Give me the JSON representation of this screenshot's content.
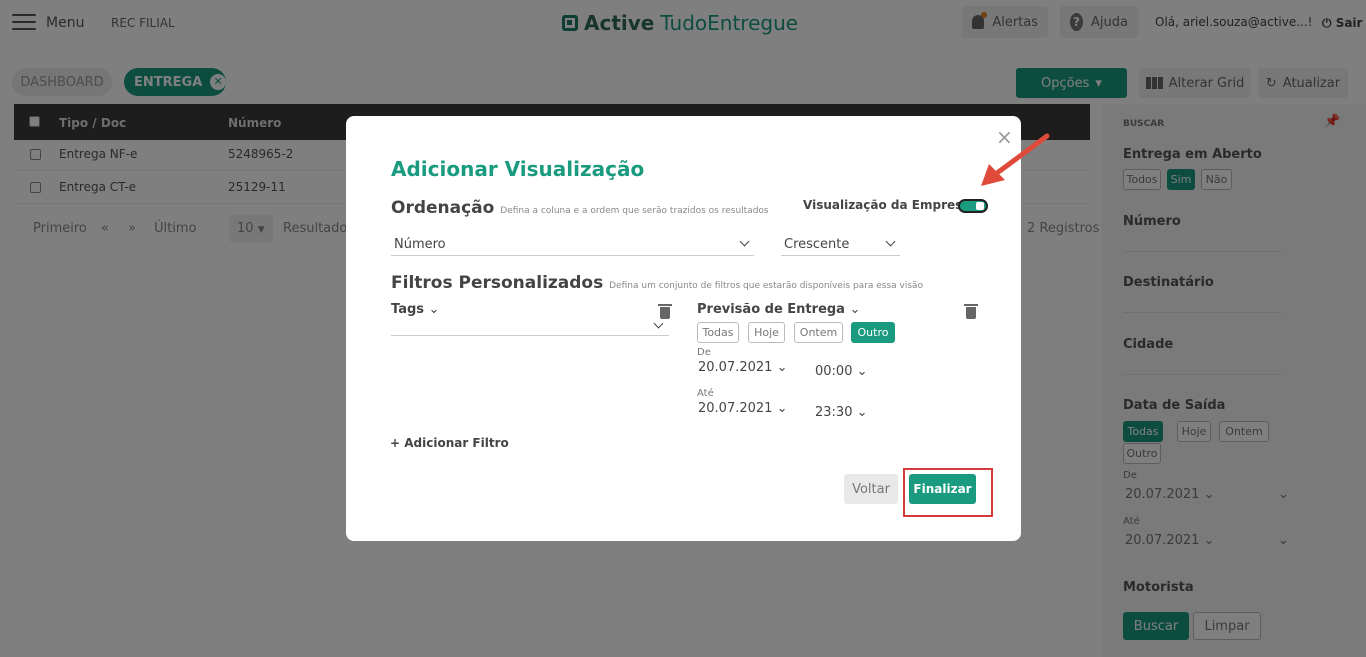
{
  "header": {
    "menu_label": "Menu",
    "filial": "REC FILIAL",
    "logo_primary": "Active",
    "logo_secondary": "TudoEntregue",
    "alertas": "Alertas",
    "ajuda": "Ajuda",
    "user": "Olá, ariel.souza@active...!",
    "sair": "Sair"
  },
  "tabs": {
    "dashboard": "DASHBOARD",
    "entrega": "ENTREGA"
  },
  "toolbar": {
    "opcoes": "Opções",
    "alterar_grid": "Alterar Grid",
    "atualizar": "Atualizar"
  },
  "table": {
    "headers": [
      "Tipo / Doc",
      "Número"
    ],
    "rows": [
      {
        "tipo": "Entrega NF-e",
        "numero": "5248965-2"
      },
      {
        "tipo": "Entrega CT-e",
        "numero": "25129-11"
      }
    ],
    "pager": {
      "primeiro": "Primeiro",
      "prev": "«",
      "next": "»",
      "ultimo": "Último",
      "page_size": "10",
      "resultados": "Resultados",
      "registros": "2 Registros"
    }
  },
  "panel": {
    "buscar_title": "BUSCAR",
    "entrega_aberto": "Entrega em Aberto",
    "entrega_opts": [
      "Todos",
      "Sim",
      "Não"
    ],
    "numero": "Número",
    "destinatario": "Destinatário",
    "cidade": "Cidade",
    "data_saida": "Data de Saída",
    "data_opts": [
      "Todas",
      "Hoje",
      "Ontem",
      "Outro"
    ],
    "de": "De",
    "de_value": "20.07.2021",
    "ate": "Até",
    "ate_value": "20.07.2021",
    "motorista": "Motorista",
    "buscar_btn": "Buscar",
    "limpar_btn": "Limpar"
  },
  "modal": {
    "close": "×",
    "title": "Adicionar Visualização",
    "ordenacao": "Ordenação",
    "ordenacao_hint": "Defina a coluna e a ordem que serão trazidos os resultados",
    "empresa_label": "Visualização da Empresa",
    "sort_column": "Número",
    "sort_order": "Crescente",
    "filtros": "Filtros Personalizados",
    "filtros_hint": "Defina um conjunto de filtros que estarão disponíveis para essa visão",
    "tags_label": "Tags",
    "previsao_label": "Previsão de Entrega",
    "previsao_opts": [
      "Todas",
      "Hoje",
      "Ontem",
      "Outro"
    ],
    "de_label": "De",
    "de_date": "20.07.2021",
    "de_time": "00:00",
    "ate_label": "Até",
    "ate_date": "20.07.2021",
    "ate_time": "23:30",
    "add_filter": "+ Adicionar Filtro",
    "voltar": "Voltar",
    "finalizar": "Finalizar"
  },
  "colors": {
    "accent": "#1a9b80",
    "annotation": "#d63b3b"
  }
}
